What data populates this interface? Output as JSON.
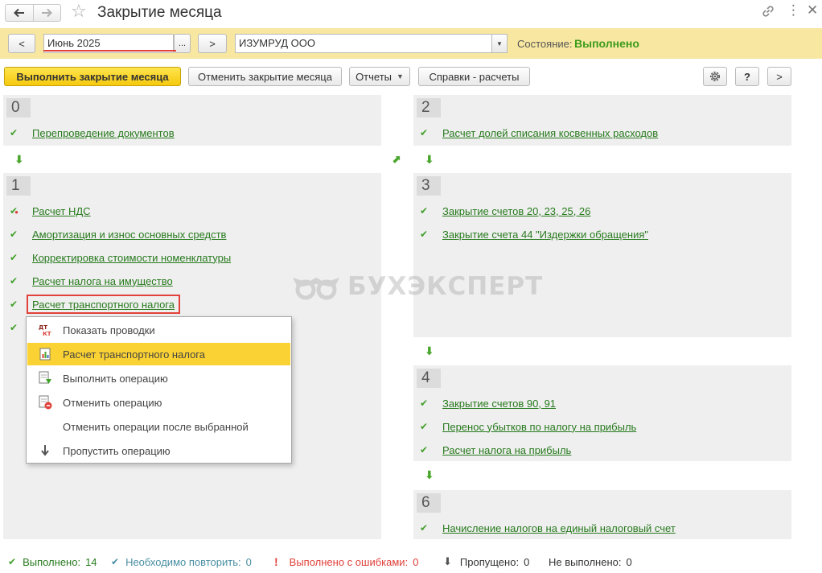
{
  "window": {
    "title": "Закрытие месяца",
    "icons": {
      "back": "arrow-left-icon",
      "forward": "arrow-right-icon",
      "favorite": "star-icon",
      "link": "link-icon",
      "more": "more-vertical-icon",
      "close": "close-icon"
    }
  },
  "header": {
    "prev_label": "<",
    "period_value": "Июнь 2025",
    "period_select_label": "...",
    "next_label": ">",
    "organization_value": "ИЗУМРУД ООО",
    "state_label": "Состояние:",
    "state_value": "Выполнено"
  },
  "toolbar": {
    "execute_label": "Выполнить закрытие месяца",
    "cancel_label": "Отменить закрытие месяца",
    "reports_label": "Отчеты",
    "references_label": "Справки - расчеты",
    "help_label": "?",
    "more_label": ">"
  },
  "stages": [
    {
      "number": "0",
      "operations": [
        "Перепроведение документов"
      ]
    },
    {
      "number": "1",
      "operations": [
        "Расчет НДС",
        "Амортизация и износ основных средств",
        "Корректировка стоимости номенклатуры",
        "Расчет налога на имущество",
        "Расчет транспортного налога"
      ]
    },
    {
      "number": "2",
      "operations": [
        "Расчет долей списания косвенных расходов"
      ]
    },
    {
      "number": "3",
      "operations": [
        "Закрытие счетов 20, 23, 25, 26",
        "Закрытие счета 44 \"Издержки обращения\""
      ]
    },
    {
      "number": "4",
      "operations": [
        "Закрытие счетов 90, 91",
        "Перенос убытков по налогу на прибыль",
        "Расчет налога на прибыль"
      ]
    },
    {
      "number": "6",
      "operations": [
        "Начисление налогов на единый налоговый счет"
      ]
    }
  ],
  "context_menu": {
    "items": [
      {
        "label": "Показать проводки",
        "icon": "dt-kt-icon"
      },
      {
        "label": "Расчет транспортного налога",
        "icon": "report-icon",
        "active": true
      },
      {
        "label": "Выполнить операцию",
        "icon": "execute-operation-icon"
      },
      {
        "label": "Отменить операцию",
        "icon": "cancel-operation-icon"
      },
      {
        "label": "Отменить операции после выбранной",
        "icon": ""
      },
      {
        "label": "Пропустить операцию",
        "icon": "skip-arrow-icon"
      }
    ]
  },
  "watermark": {
    "text": "БУХЭКСПЕРТ"
  },
  "status_bar": {
    "done_label": "Выполнено:",
    "done_count": "14",
    "repeat_label": "Необходимо повторить:",
    "repeat_count": "0",
    "errors_label": "Выполнено с ошибками:",
    "errors_count": "0",
    "skipped_label": "Пропущено:",
    "skipped_count": "0",
    "not_done_label": "Не выполнено:",
    "not_done_count": "0"
  },
  "colors": {
    "accent_yellow": "#f7e7a1",
    "primary_button": "#f5c90f",
    "link_green": "#277a1d",
    "check_green": "#41a02a",
    "state_green": "#3c9b1a",
    "error_red": "#e0413a",
    "repeat_teal": "#4a8fa3",
    "panel_gray": "#efefef"
  }
}
